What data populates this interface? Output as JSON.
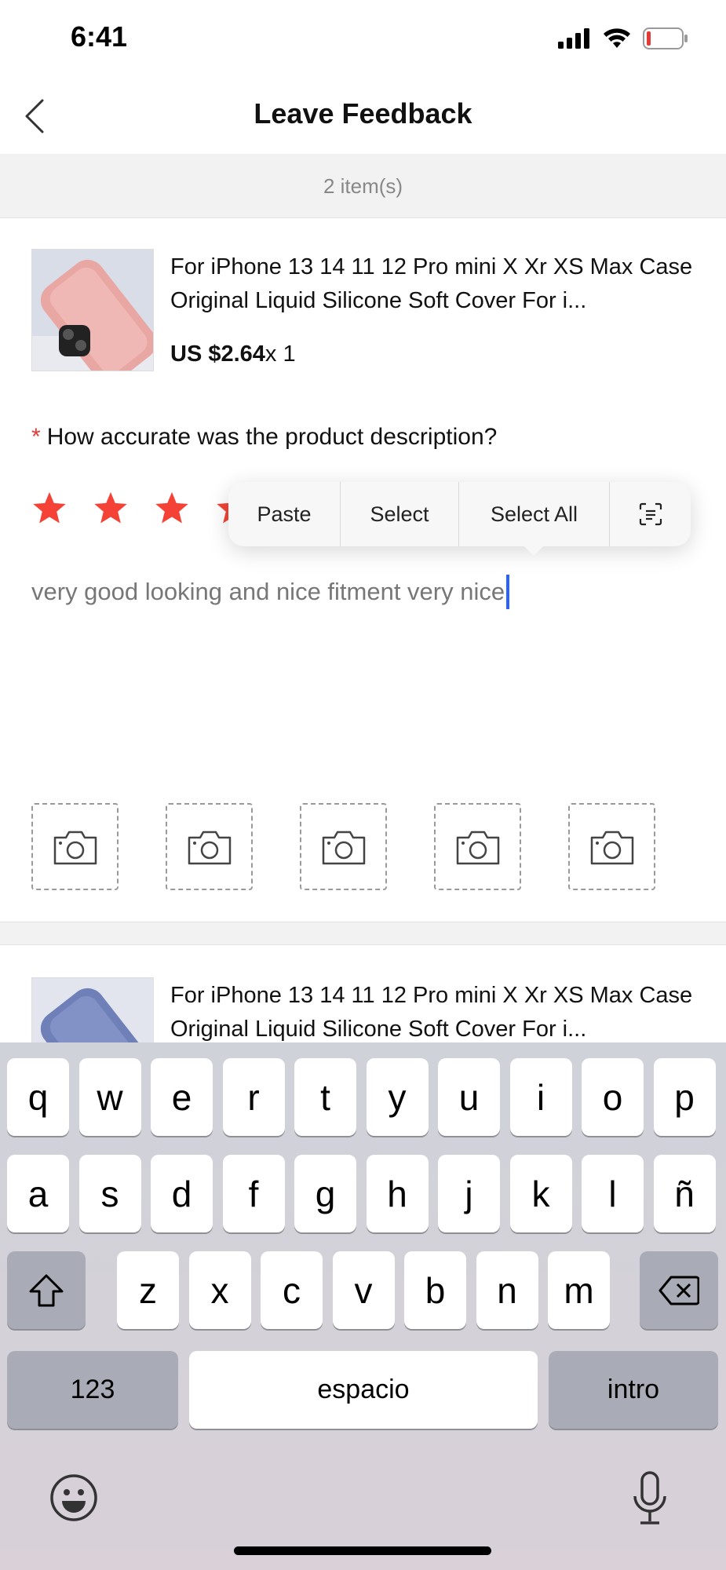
{
  "status_bar": {
    "time": "6:41"
  },
  "header": {
    "title": "Leave Feedback"
  },
  "items_count": "2 item(s)",
  "products": [
    {
      "title": "For iPhone 13 14 11 12 Pro mini X Xr XS Max Case Original Liquid Silicone Soft Cover For i...",
      "price": "US $2.64",
      "quantity": "x 1",
      "image_color": "#e9a7a4"
    },
    {
      "title": "For iPhone 13 14 11 12 Pro mini X Xr XS Max Case Original Liquid Silicone Soft Cover For i...",
      "image_color": "#6f7fb8"
    }
  ],
  "question": {
    "required_mark": "*",
    "text": "How accurate was the product description?"
  },
  "rating": {
    "filled_stars_visible": 4,
    "star_color": "#f44336"
  },
  "review": {
    "text": "very good looking and nice fitment very nice"
  },
  "context_menu": {
    "items": [
      "Paste",
      "Select",
      "Select All"
    ],
    "icon": "scan-text-icon"
  },
  "photo_slots": {
    "count": 5,
    "icon": "camera-icon"
  },
  "keyboard": {
    "row1": [
      "q",
      "w",
      "e",
      "r",
      "t",
      "y",
      "u",
      "i",
      "o",
      "p"
    ],
    "row2": [
      "a",
      "s",
      "d",
      "f",
      "g",
      "h",
      "j",
      "k",
      "l",
      "ñ"
    ],
    "row3": [
      "z",
      "x",
      "c",
      "v",
      "b",
      "n",
      "m"
    ],
    "numbers_label": "123",
    "space_label": "espacio",
    "return_label": "intro"
  }
}
